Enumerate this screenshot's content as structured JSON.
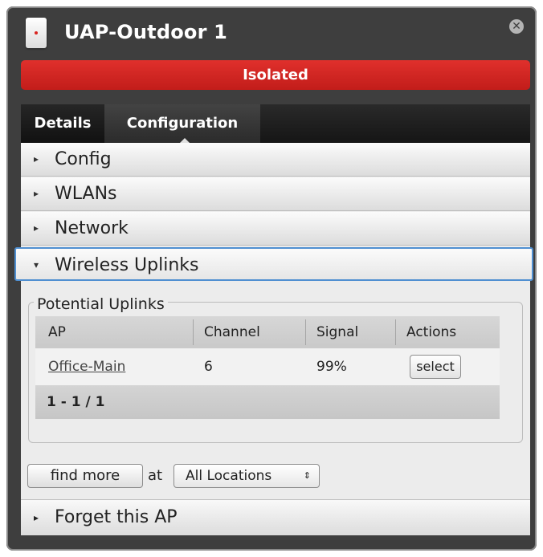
{
  "window": {
    "title": "UAP-Outdoor 1",
    "close_glyph": "✕",
    "status": "Isolated",
    "status_color": "#d9231f",
    "device_icon": "uap-device-icon"
  },
  "tabs": [
    {
      "label": "Details",
      "active": false
    },
    {
      "label": "Configuration",
      "active": true
    }
  ],
  "sections": {
    "config": "Config",
    "wlans": "WLANs",
    "network": "Network",
    "wireless_uplinks": "Wireless Uplinks",
    "forget": "Forget this AP"
  },
  "uplinks": {
    "legend": "Potential Uplinks",
    "columns": [
      "AP",
      "Channel",
      "Signal",
      "Actions"
    ],
    "rows": [
      {
        "ap": "Office-Main",
        "channel": "6",
        "signal": "99%",
        "action": "select"
      }
    ],
    "pager": "1 - 1 / 1"
  },
  "find": {
    "button": "find more",
    "at": "at",
    "location": "All Locations"
  },
  "icons": {
    "collapsed": "▸",
    "expanded": "▾",
    "select_arrows": "⇕"
  }
}
